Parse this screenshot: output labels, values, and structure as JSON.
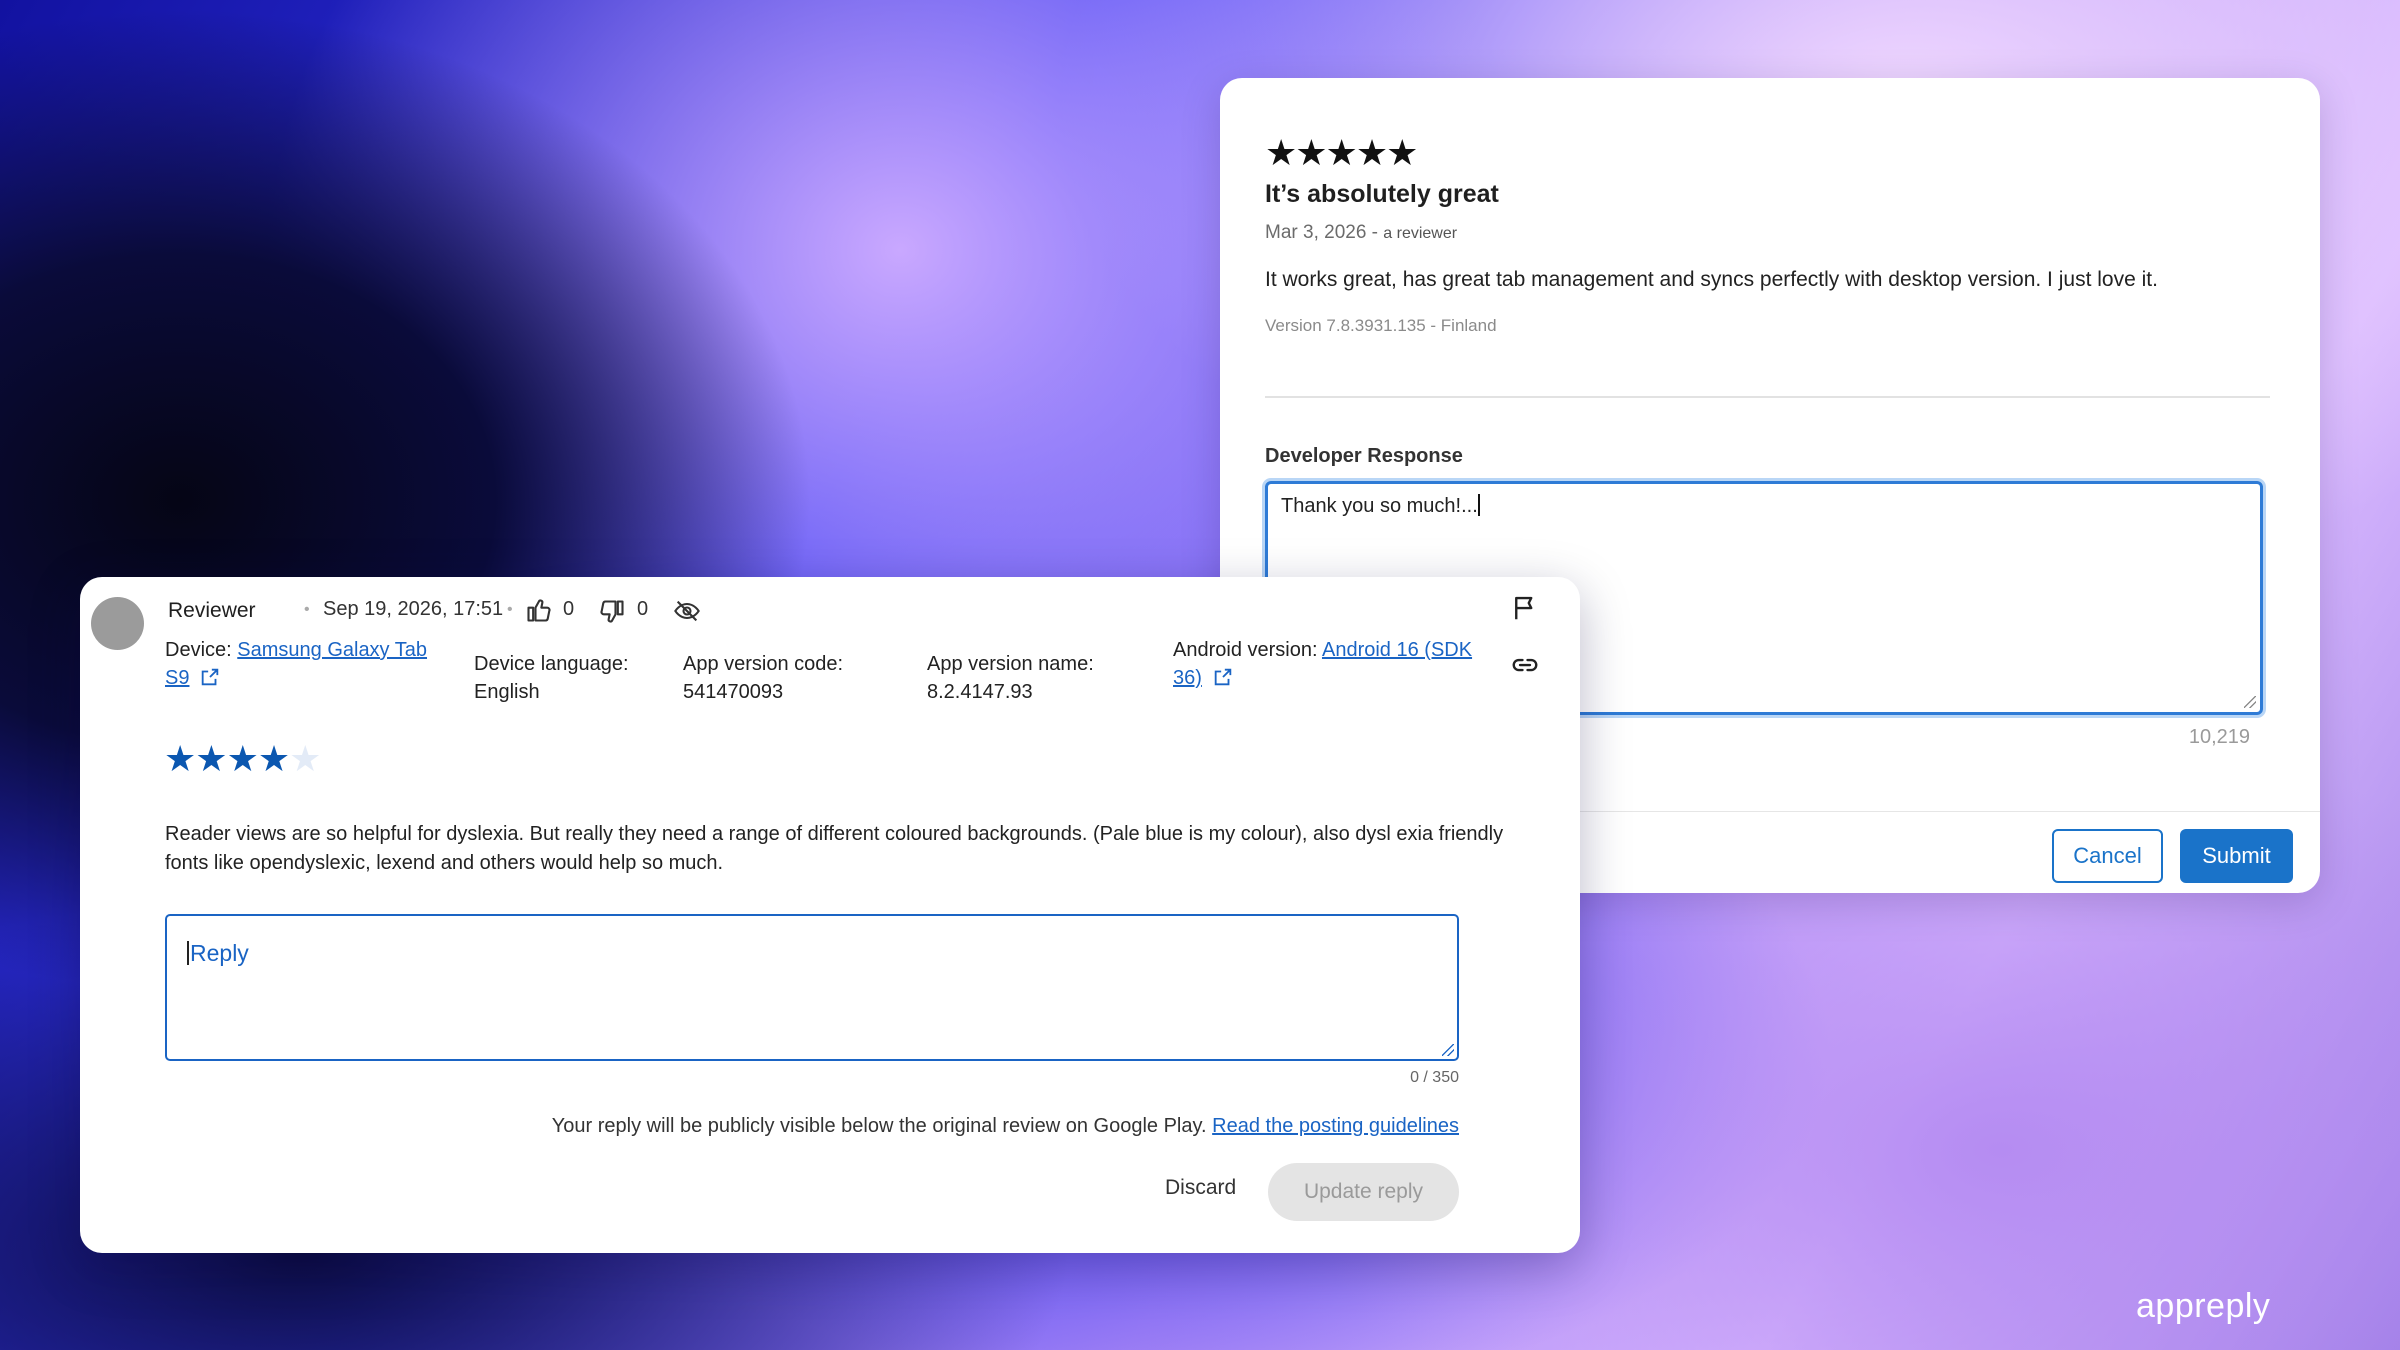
{
  "back_card": {
    "stars": "★★★★★",
    "title": "It’s absolutely great",
    "date": "Mar 3, 2026 -",
    "reviewer_note": "a reviewer",
    "body": "It works great, has great tab management and syncs perfectly with desktop version. I just love it.",
    "version": "Version 7.8.3931.135 - Finland",
    "response_label": "Developer Response",
    "response_value": "Thank you so much!...",
    "count": "10,219",
    "cancel_label": "Cancel",
    "submit_label": "Submit"
  },
  "front_card": {
    "reviewer": "Reviewer",
    "date": "Sep 19, 2026, 17:51",
    "likes": "0",
    "dislikes": "0",
    "device_label": "Device:",
    "device_link_1": "Samsung Galaxy Tab",
    "device_link_2": "S9",
    "device_language_label": "Device language:",
    "device_language_value": "English",
    "app_version_code_label": "App version code:",
    "app_version_code_value": "541470093",
    "app_version_name_label": "App version name:",
    "app_version_name_value": "8.2.4147.93",
    "android_version_label": "Android version:",
    "android_link_1": "Android 16 (SDK",
    "android_link_2": "36)",
    "rating": 4,
    "rating_max": 5,
    "review_text": "Reader views are so helpful for dyslexia. But really they need a range of different coloured backgrounds. (Pale blue is my colour), also dysl exia friendly fonts like opendyslexic, lexend and others would help so much.",
    "reply_placeholder": "Reply",
    "counter": "0 / 350",
    "notice": "Your reply will be publicly visible below the original review on Google Play.",
    "guidelines_link": "Read the posting guidelines",
    "discard_label": "Discard",
    "update_label": "Update reply"
  },
  "brand": "appreply",
  "colors": {
    "link": "#1a64c4",
    "primary_button": "#1a73c9",
    "star_on": "#0b57b0"
  }
}
